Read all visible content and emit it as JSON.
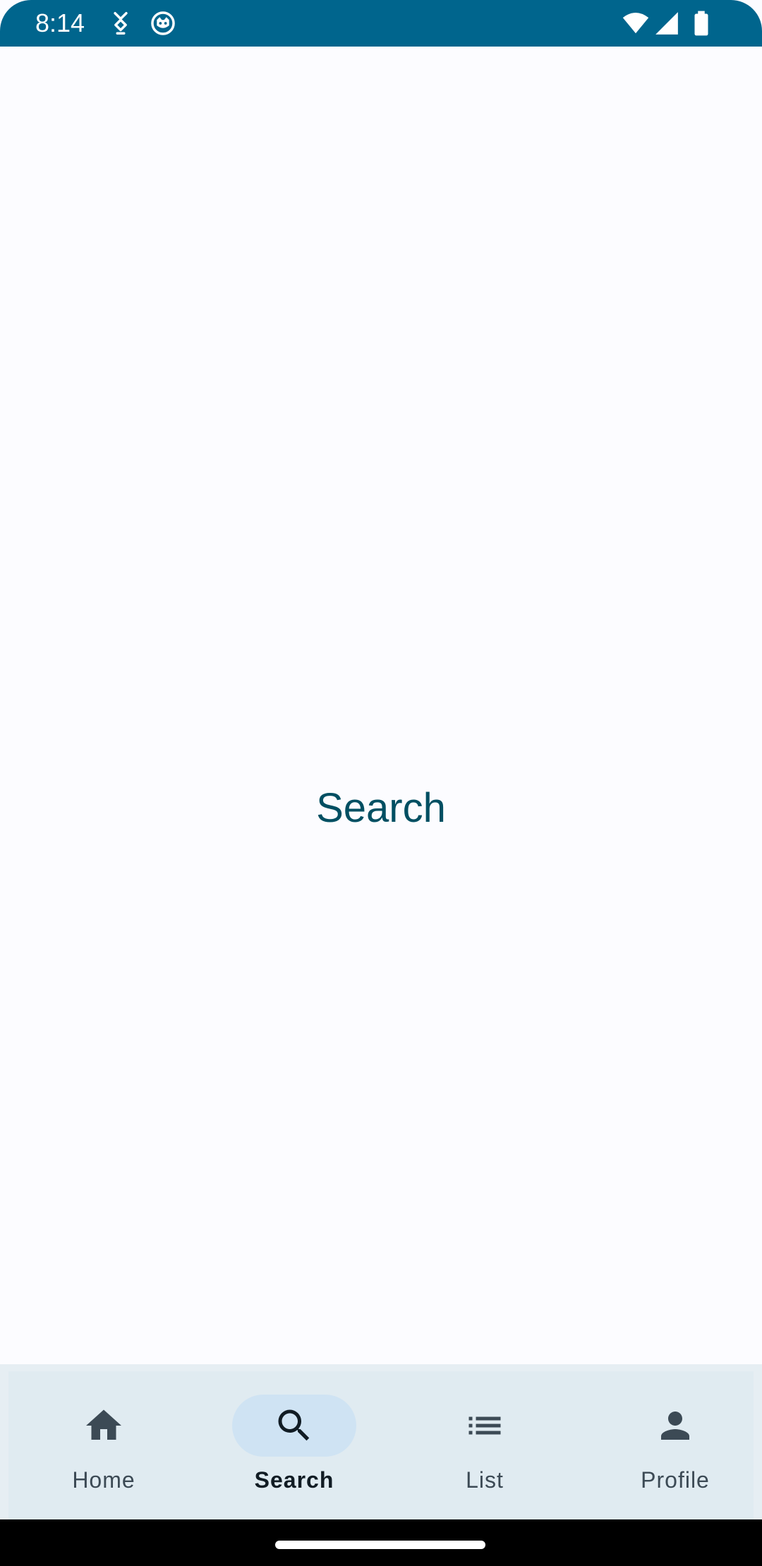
{
  "status_bar": {
    "time": "8:14",
    "icons": [
      "cat-notification-icon",
      "circle-face-icon",
      "wifi-icon",
      "cellular-signal-icon",
      "battery-icon"
    ],
    "background_color": "#00658d"
  },
  "main": {
    "title": "Search",
    "title_color": "#004f62"
  },
  "bottom_nav": {
    "selected": "Search",
    "items": [
      {
        "label": "Home",
        "icon": "home-icon"
      },
      {
        "label": "Search",
        "icon": "search-icon"
      },
      {
        "label": "List",
        "icon": "list-icon"
      },
      {
        "label": "Profile",
        "icon": "person-icon"
      }
    ],
    "active_indicator_color": "#cfe3f3"
  }
}
